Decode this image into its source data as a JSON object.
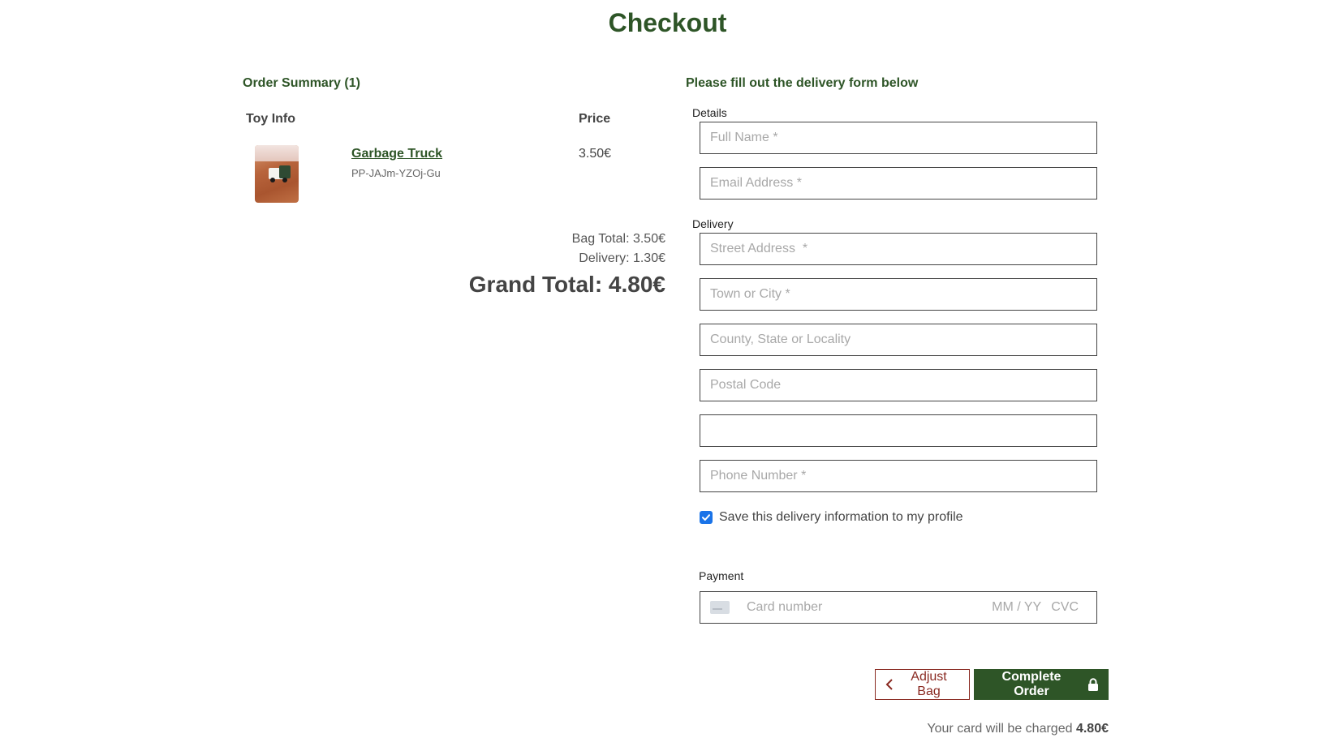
{
  "page": {
    "title": "Checkout"
  },
  "summary": {
    "title": "Order Summary (1)",
    "col_toy": "Toy Info",
    "col_price": "Price",
    "item": {
      "name": "Garbage Truck",
      "sku": "PP-JAJm-YZOj-Gu",
      "price": "3.50€",
      "image_icon": "toy-photo"
    },
    "bag_total": "Bag Total: 3.50€",
    "delivery": "Delivery: 1.30€",
    "grand_total": "Grand Total: 4.80€"
  },
  "form": {
    "title": "Please fill out the delivery form below",
    "details_label": "Details",
    "delivery_label": "Delivery",
    "payment_label": "Payment",
    "fields": {
      "full_name": {
        "placeholder": "Full Name *",
        "value": ""
      },
      "email": {
        "placeholder": "Email Address *",
        "value": ""
      },
      "street": {
        "placeholder": "Street Address  *",
        "value": ""
      },
      "town": {
        "placeholder": "Town or City *",
        "value": ""
      },
      "county": {
        "placeholder": "County, State or Locality",
        "value": ""
      },
      "postal": {
        "placeholder": "Postal Code",
        "value": ""
      },
      "country": {
        "placeholder": "",
        "value": ""
      },
      "phone": {
        "placeholder": "Phone Number *",
        "value": ""
      }
    },
    "save_info": {
      "label": "Save this delivery information to my profile",
      "checked": true
    },
    "card": {
      "number_placeholder": "Card number",
      "expiry_placeholder": "MM / YY",
      "cvc_placeholder": "CVC"
    }
  },
  "actions": {
    "adjust_bag": "Adjust Bag",
    "complete_order": "Complete Order",
    "charge_prefix": "Your card will be charged",
    "charge_amount": "4.80€"
  },
  "colors": {
    "brand_green": "#2e5527",
    "adjust_red": "#8a2a22",
    "checkbox_blue": "#1a73e8"
  }
}
